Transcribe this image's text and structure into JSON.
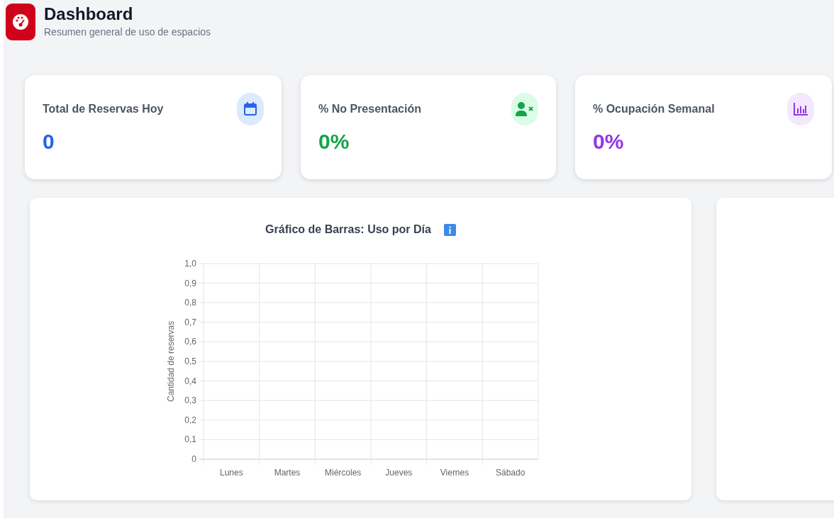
{
  "header": {
    "title": "Dashboard",
    "subtitle": "Resumen general de uso de espacios"
  },
  "stats": [
    {
      "label": "Total de Reservas Hoy",
      "value": "0",
      "kind": "calendar",
      "color": "#2563eb"
    },
    {
      "label": "% No Presentación",
      "value": "0%",
      "kind": "user-x",
      "color": "#16a34a"
    },
    {
      "label": "% Ocupación Semanal",
      "value": "0%",
      "kind": "bars",
      "color": "#9333ea"
    }
  ],
  "usage_chart": {
    "title": "Gráfico de Barras: Uso por Día",
    "chart_data": {
      "type": "bar",
      "ylabel": "Cantidad de reservas",
      "categories": [
        "Lunes",
        "Martes",
        "Miércoles",
        "Jueves",
        "Viernes",
        "Sábado"
      ],
      "values": [
        0,
        0,
        0,
        0,
        0,
        0
      ],
      "grid": true,
      "ylim": [
        0,
        1
      ],
      "yticks": [
        {
          "value": 0,
          "label": "0"
        },
        {
          "value": 0.1,
          "label": "0,1"
        },
        {
          "value": 0.2,
          "label": "0,2"
        },
        {
          "value": 0.3,
          "label": "0,3"
        },
        {
          "value": 0.4,
          "label": "0,4"
        },
        {
          "value": 0.5,
          "label": "0,5"
        },
        {
          "value": 0.6,
          "label": "0,6"
        },
        {
          "value": 0.7,
          "label": "0,7"
        },
        {
          "value": 0.8,
          "label": "0,8"
        },
        {
          "value": 0.9,
          "label": "0,9"
        },
        {
          "value": 1,
          "label": "1,0"
        }
      ]
    }
  }
}
